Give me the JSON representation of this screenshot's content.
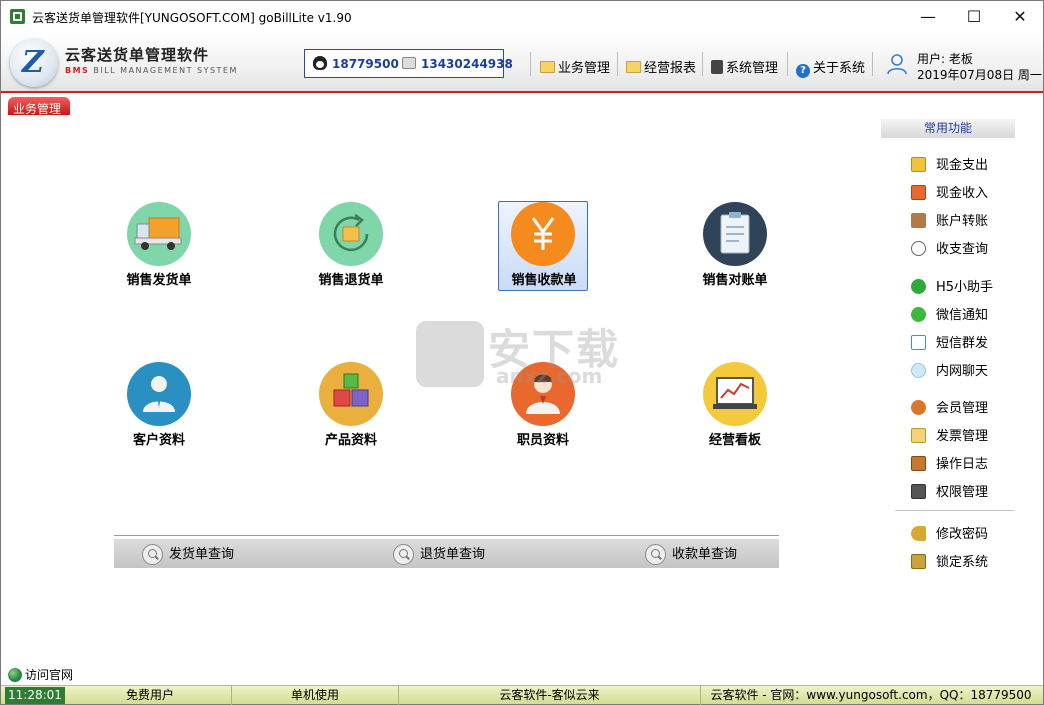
{
  "window": {
    "title": "云客送货单管理软件[YUNGOSOFT.COM]  goBillLite v1.90",
    "controls": [
      "—",
      "☐",
      "✕"
    ]
  },
  "brand": {
    "name_cn": "云客送货单管理软件",
    "name_en_prefix": "BMS",
    "name_en_rest": " BILL MANAGEMENT SYSTEM"
  },
  "contact": {
    "qq": "18779500",
    "phone": "13430244938"
  },
  "menu": [
    {
      "label": "业务管理",
      "icon": "folder-icon"
    },
    {
      "label": "经营报表",
      "icon": "folder-icon"
    },
    {
      "label": "系统管理",
      "icon": "system-icon"
    },
    {
      "label": "关于系统",
      "icon": "help-icon"
    }
  ],
  "user": {
    "line1": "用户: 老板",
    "line2": "2019年07月08日 周一"
  },
  "tab": {
    "label": "业务管理"
  },
  "tiles": [
    {
      "label": "销售发货单",
      "icon": "delivery-truck-icon",
      "color": "#7fd6a8"
    },
    {
      "label": "销售退货单",
      "icon": "return-refresh-icon",
      "color": "#7fd6a8"
    },
    {
      "label": "销售收款单",
      "icon": "yuan-coin-icon",
      "color": "#f58a1f",
      "selected": true
    },
    {
      "label": "销售对账单",
      "icon": "clipboard-icon",
      "color": "#2f4458"
    },
    {
      "label": "客户资料",
      "icon": "customer-person-icon",
      "color": "#2a8fc1"
    },
    {
      "label": "产品资料",
      "icon": "product-blocks-icon",
      "color": "#e9b03e"
    },
    {
      "label": "职员资料",
      "icon": "staff-person-icon",
      "color": "#e8682e"
    },
    {
      "label": "经营看板",
      "icon": "dashboard-chart-icon",
      "color": "#f5c93c"
    }
  ],
  "queries": [
    {
      "label": "发货单查询"
    },
    {
      "label": "退货单查询"
    },
    {
      "label": "收款单查询"
    }
  ],
  "side_panel": {
    "title": "常用功能",
    "groups": [
      [
        {
          "label": "现金支出",
          "icon": "cash-out-icon",
          "color": "#f0c43a"
        },
        {
          "label": "现金收入",
          "icon": "cash-in-icon",
          "color": "#e8682e"
        },
        {
          "label": "账户转账",
          "icon": "transfer-sign-icon",
          "color": "#b07a4a"
        },
        {
          "label": "收支查询",
          "icon": "query-icon",
          "color": "#666666"
        }
      ],
      [
        {
          "label": "H5小助手",
          "icon": "check-circle-icon",
          "color": "#2eaa3d"
        },
        {
          "label": "微信通知",
          "icon": "wechat-icon",
          "color": "#3cb93c"
        },
        {
          "label": "短信群发",
          "icon": "sms-icon",
          "color": "#3a8fd6"
        },
        {
          "label": "内网聊天",
          "icon": "chat-bubble-icon",
          "color": "#8ec7ef"
        }
      ],
      [
        {
          "label": "会员管理",
          "icon": "member-badge-icon",
          "color": "#d9762a"
        },
        {
          "label": "发票管理",
          "icon": "invoice-icon",
          "color": "#f3d27a"
        },
        {
          "label": "操作日志",
          "icon": "log-book-icon",
          "color": "#c8782c"
        },
        {
          "label": "权限管理",
          "icon": "monitor-icon",
          "color": "#555555"
        }
      ],
      [
        {
          "label": "修改密码",
          "icon": "key-icon",
          "color": "#d8a92e"
        },
        {
          "label": "锁定系统",
          "icon": "lock-icon",
          "color": "#c8a23a"
        }
      ]
    ]
  },
  "watermark": {
    "text": "安下载",
    "sub": "anxz.com"
  },
  "footer": {
    "visit_label": "访问官网"
  },
  "status_bar": {
    "time": "11:28:01",
    "license": "免费用户",
    "mode": "单机使用",
    "slogan": "云客软件-客似云来",
    "site": "云客软件 - 官网：www.yungosoft.com，QQ：18779500"
  }
}
